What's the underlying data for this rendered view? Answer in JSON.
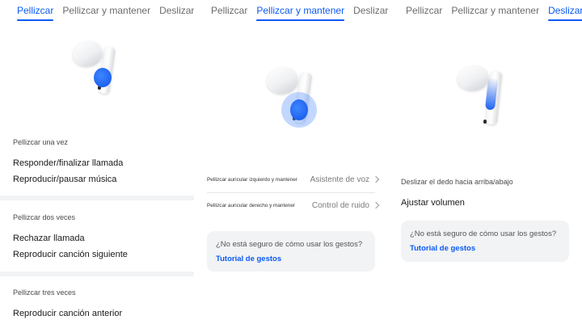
{
  "panel_pinch": {
    "tabs": [
      "Pellizcar",
      "Pellizcar y mantener",
      "Deslizar"
    ],
    "active_tab": "Pellizcar",
    "once_title": "Pellizcar una vez",
    "once_items": [
      "Responder/finalizar llamada",
      "Reproducir/pausar música"
    ],
    "twice_title": "Pellizcar dos veces",
    "twice_items": [
      "Rechazar llamada",
      "Reproducir canción siguiente"
    ],
    "thrice_title": "Pellizcar tres veces",
    "thrice_items": [
      "Reproducir canción anterior"
    ]
  },
  "panel_hold": {
    "tabs": [
      "Pellizcar",
      "Pellizcar y mantener",
      "Deslizar"
    ],
    "active_tab": "Pellizcar y mantener",
    "rows": [
      {
        "label": "Pellizcar auricular izquierdo y mantener",
        "value": "Asistente de voz"
      },
      {
        "label": "Pellizcar auricular derecho y mantener",
        "value": "Control de ruido"
      }
    ],
    "help_question": "¿No está seguro de cómo usar los gestos?",
    "help_link": "Tutorial de gestos"
  },
  "panel_swipe": {
    "tabs": [
      "Pellizcar",
      "Pellizcar y mantener",
      "Deslizar"
    ],
    "active_tab": "Deslizar",
    "section_title": "Deslizar el dedo hacia arriba/abajo",
    "item": "Ajustar volumen",
    "help_question": "¿No está seguro de cómo usar los gestos?",
    "help_link": "Tutorial de gestos"
  },
  "colors": {
    "accent": "#0a59f7",
    "divider": "#f1f3f5",
    "gesture_dot": "#1e63f0"
  }
}
